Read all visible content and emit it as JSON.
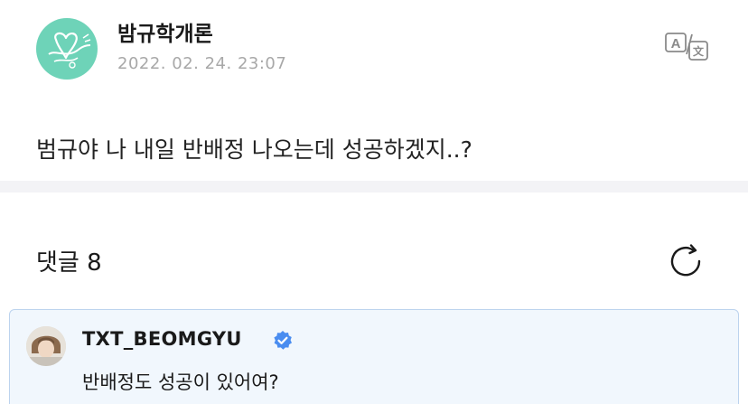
{
  "post": {
    "author": "밤규학개론",
    "date": "2022. 02. 24. 23:07",
    "body": "범규야 나 내일 반배정 나오는데 성공하겠지..?"
  },
  "icons": {
    "translate": "translate-icon",
    "refresh": "refresh-icon",
    "verified": "verified-badge-icon"
  },
  "comments": {
    "header": "댓글 8",
    "items": [
      {
        "author": "TXT_BEOMGYU",
        "verified": true,
        "text": "반배정도 성공이 있어여?"
      }
    ]
  },
  "colors": {
    "accent": "#4a8df0",
    "avatar_bg": "#6ed3b8",
    "card_bg": "#f1f7fd",
    "card_border": "#bcd3ee",
    "divider": "#f3f3f6",
    "date": "#a8a8a8"
  }
}
